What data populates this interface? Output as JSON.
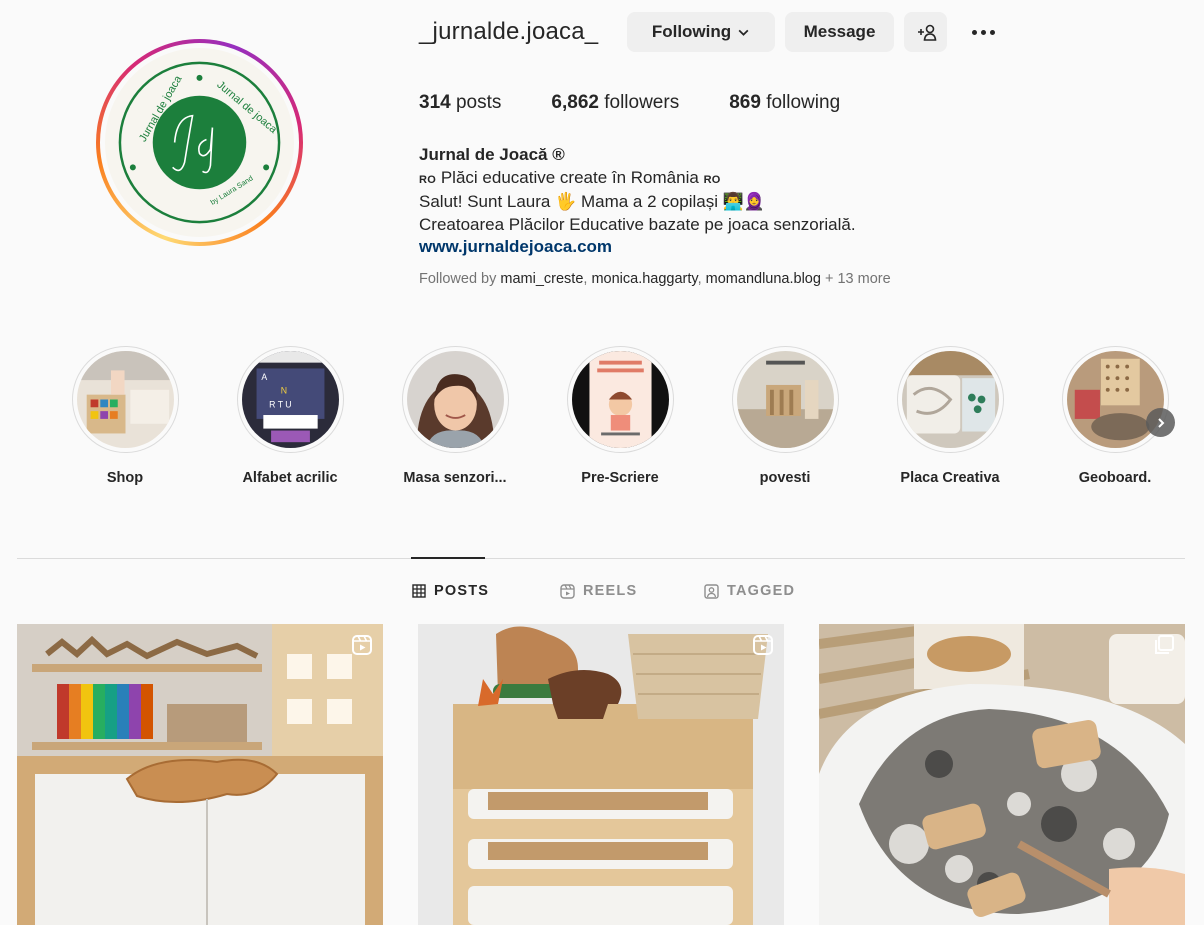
{
  "profile": {
    "username": "_jurnalde.joaca_",
    "avatar": {
      "ring_text_top_left": "Jurnal de joaca",
      "ring_text_top_right": "Jurnal de joaca",
      "monogram": "Jdj",
      "signature": "by Laura Sand",
      "brand_green": "#1c7f3c"
    },
    "buttons": {
      "following_label": "Following",
      "message_label": "Message",
      "add_user_icon": "add-person-icon",
      "more_icon": "ellipsis-icon"
    },
    "stats": {
      "posts_count": "314",
      "posts_label": "posts",
      "followers_count": "6,862",
      "followers_label": "followers",
      "following_count": "869",
      "following_label": "following"
    },
    "bio": {
      "name": "Jurnal de Joacă ®",
      "line1_flag": "RO",
      "line1_text": "Plăci educative create în România",
      "line2_text": "Salut! Sunt Laura 🖐 Mama a 2 copilași 👨‍💻🧕",
      "line3_text": "Creatoarea Plăcilor Educative bazate pe joaca senzorială.",
      "website": "www.jurnaldejoaca.com"
    },
    "followed_by": {
      "prefix": "Followed by",
      "users": [
        "mami_creste",
        "monica.haggarty",
        "momandluna.blog"
      ],
      "more": "+ 13 more"
    }
  },
  "highlights": [
    {
      "label": "Shop"
    },
    {
      "label": "Alfabet acrilic"
    },
    {
      "label": "Masa senzori..."
    },
    {
      "label": "Pre-Scriere"
    },
    {
      "label": "povesti"
    },
    {
      "label": "Placa Creativa"
    },
    {
      "label": "Geoboard."
    }
  ],
  "tabs": [
    {
      "label": "POSTS",
      "icon": "grid-icon",
      "active": true
    },
    {
      "label": "REELS",
      "icon": "reels-icon",
      "active": false
    },
    {
      "label": "TAGGED",
      "icon": "tagged-icon",
      "active": false
    }
  ],
  "posts": [
    {
      "type": "reel",
      "badge_icon": "reel-icon"
    },
    {
      "type": "reel",
      "badge_icon": "reel-icon"
    },
    {
      "type": "carousel",
      "badge_icon": "carousel-icon"
    }
  ],
  "colors": {
    "link": "#00376b",
    "button_bg": "#efefef",
    "divider": "#dbdbdb",
    "muted_text": "#737373"
  }
}
